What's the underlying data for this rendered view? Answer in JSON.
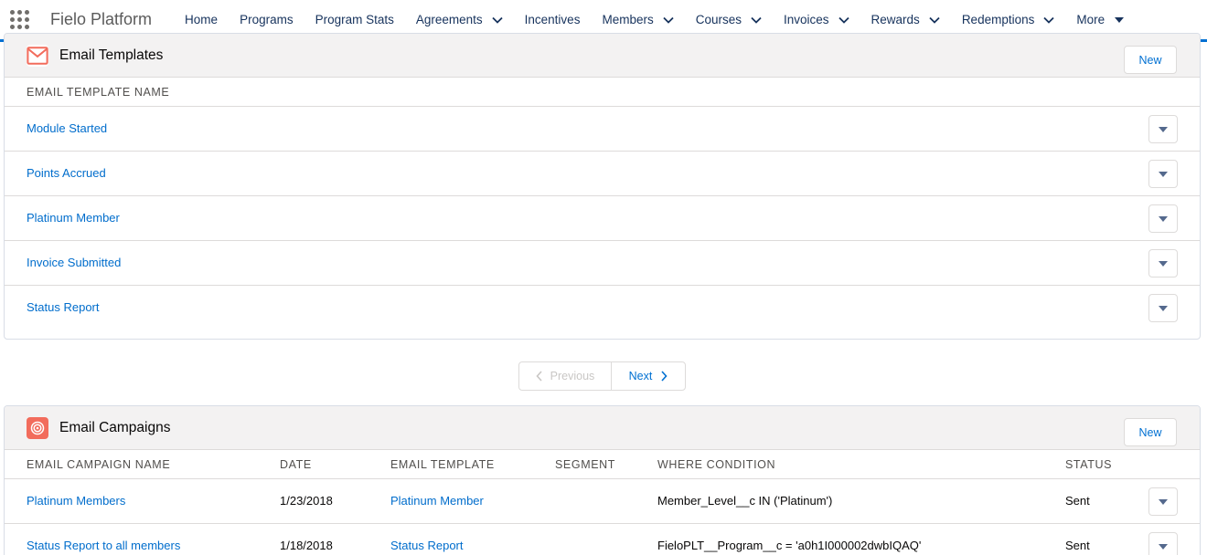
{
  "app": {
    "name": "Fielo Platform"
  },
  "nav": {
    "items": [
      {
        "label": "Home",
        "dropdown": false
      },
      {
        "label": "Programs",
        "dropdown": false
      },
      {
        "label": "Program Stats",
        "dropdown": false
      },
      {
        "label": "Agreements",
        "dropdown": true
      },
      {
        "label": "Incentives",
        "dropdown": false
      },
      {
        "label": "Members",
        "dropdown": true
      },
      {
        "label": "Courses",
        "dropdown": true
      },
      {
        "label": "Invoices",
        "dropdown": true
      },
      {
        "label": "Rewards",
        "dropdown": true
      },
      {
        "label": "Redemptions",
        "dropdown": true
      },
      {
        "label": "More",
        "dropdown": true
      }
    ]
  },
  "email_templates": {
    "title": "Email Templates",
    "icon": "email-icon",
    "new_label": "New",
    "column": "EMAIL TEMPLATE NAME",
    "rows": [
      "Module Started",
      "Points Accrued",
      "Platinum Member",
      "Invoice Submitted",
      "Status Report"
    ]
  },
  "pager": {
    "previous_label": "Previous",
    "next_label": "Next"
  },
  "email_campaigns": {
    "title": "Email Campaigns",
    "icon": "target-icon",
    "new_label": "New",
    "columns": [
      "EMAIL CAMPAIGN NAME",
      "DATE",
      "EMAIL TEMPLATE",
      "SEGMENT",
      "WHERE CONDITION",
      "STATUS"
    ],
    "rows": [
      {
        "name": "Platinum Members",
        "date": "1/23/2018",
        "template": "Platinum Member",
        "segment": "",
        "condition": "Member_Level__c IN ('Platinum')",
        "status": "Sent"
      },
      {
        "name": "Status Report to all members",
        "date": "1/18/2018",
        "template": "Status Report",
        "segment": "",
        "condition": "FieloPLT__Program__c = 'a0h1I000002dwbIQAQ'",
        "status": "Sent"
      }
    ]
  },
  "colors": {
    "accent": "#0070d2",
    "link": "#006dcc",
    "template_icon": "#f26c5c",
    "campaign_icon": "#f26c5c"
  }
}
